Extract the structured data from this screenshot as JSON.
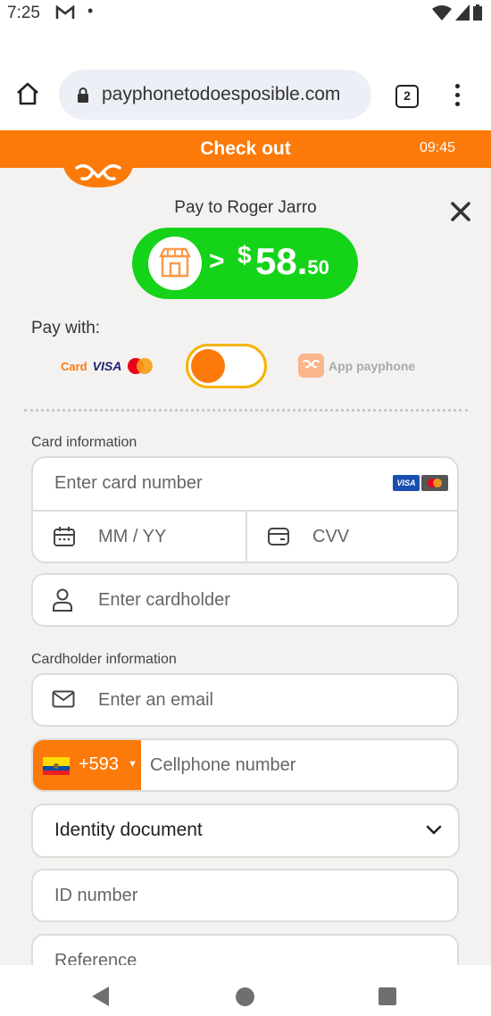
{
  "status_bar": {
    "time": "7:25",
    "mail_icon": "gmail-icon",
    "dot": "•"
  },
  "browser": {
    "url": "payphonetodoesposible.com",
    "tab_count": "2"
  },
  "checkout": {
    "title": "Check out",
    "timer": "09:45",
    "pay_to": "Pay to Roger Jarro",
    "amount_arrow": ">",
    "amount_currency": "$",
    "amount_int": "58.",
    "amount_dec": "50",
    "pay_with": "Pay with:",
    "card_option_label": "Card",
    "visa_label": "VISA",
    "app_option_label": "App payphone",
    "toggle_state": "card",
    "accent_color": "#fb7a0a",
    "amount_color": "#14d318"
  },
  "card_info": {
    "section_label": "Card information",
    "card_number_placeholder": "Enter card number",
    "mini_visa": "VISA",
    "expiry_placeholder": "MM / YY",
    "cvv_placeholder": "CVV",
    "cardholder_placeholder": "Enter cardholder"
  },
  "cardholder_info": {
    "section_label": "Cardholder information",
    "email_placeholder": "Enter an email",
    "country_code": "+593",
    "phone_placeholder": "Cellphone number",
    "document_select": "Identity document",
    "id_placeholder": "ID number",
    "reference_placeholder": "Reference"
  }
}
